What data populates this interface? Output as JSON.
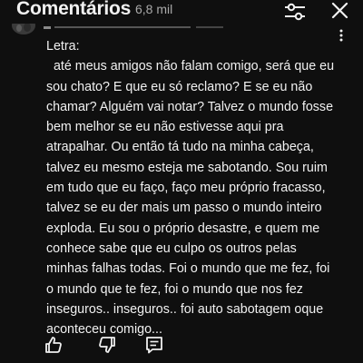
{
  "header": {
    "title": "Comentários",
    "count": "6,8 mil",
    "filter_icon": "sliders-icon",
    "close_icon": "close-icon"
  },
  "comment": {
    "lines": [
      "Letra:",
      "  até meus amigos não falam comigo, será que eu",
      "sou chato? E que eu só reclamo? E se eu não",
      "chamar? Alguém vai notar? Talvez o mundo fosse",
      "bem melhor se eu não estivesse aqui pra",
      "atrapalhar. Ou então tá tudo na minha cabeça,",
      "talvez eu mesmo esteja me sabotando. Sou ruim",
      "em tudo que eu faço, faço meu próprio fracasso,",
      "talvez se eu der mais um passo o mundo inteiro",
      "exploda. Eu sou o próprio desastre, e quem me",
      "conhece sabe que eu culpo os outros pelas",
      "minhas falhas todas. Foi o mundo que me fez, foi",
      "o mundo que te fez, foi o mundo que nos fez",
      "inseguros.. inseguros.. foi auto sabotagem oque",
      "aconteceu comigo..."
    ],
    "avatar_icon": "avatar",
    "menu_icon": "more-vertical-icon"
  },
  "actions": {
    "like_icon": "thumbs-up-icon",
    "dislike_icon": "thumbs-down-icon",
    "reply_icon": "reply-comment-icon"
  },
  "colors": {
    "background": "#0f0f0f",
    "text_primary": "#f1f1f1",
    "text_secondary": "#aaaaaa"
  }
}
